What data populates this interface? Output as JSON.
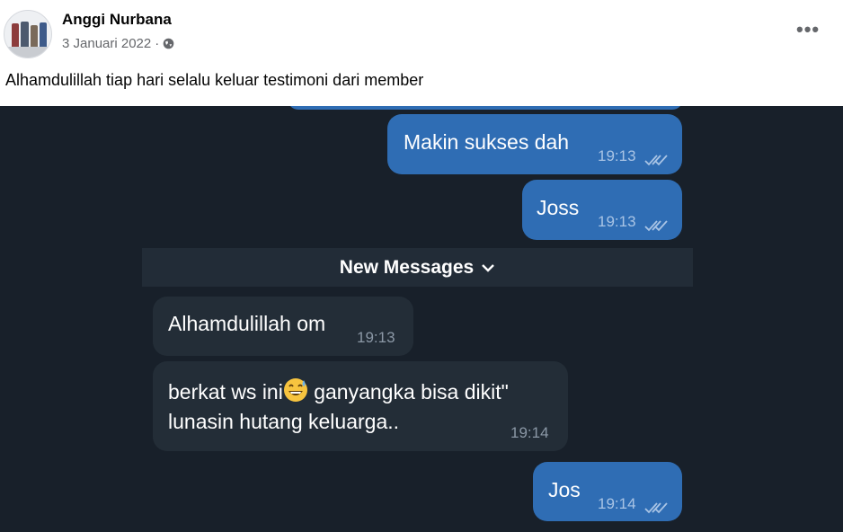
{
  "post": {
    "author": "Anggi Nurbana",
    "date": "3 Januari 2022",
    "separator": "·",
    "privacy_icon": "globe-icon",
    "more_icon": "more-options-icon",
    "more_glyph": "•••",
    "caption": "Alhamdulillah tiap hari selalu keluar testimoni dari member"
  },
  "chat": {
    "new_messages_label": "New Messages",
    "messages": [
      {
        "direction": "outgoing",
        "text": "Makin sukses dah",
        "time": "19:13",
        "status": "read"
      },
      {
        "direction": "outgoing",
        "text": "Joss",
        "time": "19:13",
        "status": "read"
      },
      {
        "direction": "incoming",
        "text": "Alhamdulillah om",
        "time": "19:13"
      },
      {
        "direction": "incoming",
        "text_before_emoji": "berkat ws ini",
        "emoji": "grinning-sweat-emoji",
        "text_after_emoji": " ganyangka bisa dikit\"",
        "line2": "lunasin hutang keluarga..",
        "time": "19:14"
      },
      {
        "direction": "outgoing",
        "text": "Jos",
        "time": "19:14",
        "status": "read"
      }
    ]
  },
  "colors": {
    "chat_background": "#18202a",
    "outgoing_bubble": "#2f6db4",
    "incoming_bubble": "#232d37",
    "read_ticks": "#a9c4e5"
  }
}
